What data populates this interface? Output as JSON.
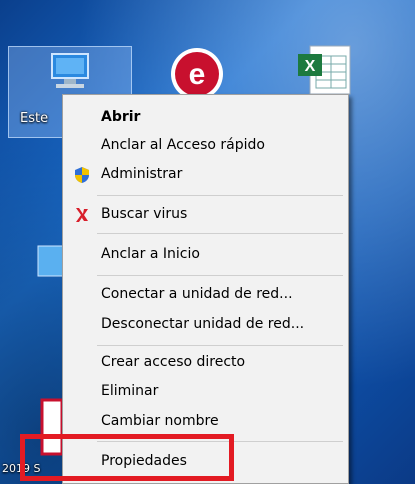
{
  "desktop": {
    "selected_icon_label": "Este",
    "bottom_left_label": "2019 S"
  },
  "menu": {
    "items": [
      {
        "label": "Abrir",
        "bold": true
      },
      {
        "label": "Anclar al Acceso rápido"
      },
      {
        "label": "Administrar",
        "icon": "uac-shield-icon"
      },
      {
        "label": "Buscar virus",
        "icon": "antivirus-icon"
      },
      {
        "label": "Anclar a Inicio"
      },
      {
        "label": "Conectar a unidad de red..."
      },
      {
        "label": "Desconectar unidad de red..."
      },
      {
        "label": "Crear acceso directo"
      },
      {
        "label": "Eliminar"
      },
      {
        "label": "Cambiar nombre"
      },
      {
        "label": "Propiedades"
      }
    ]
  },
  "colors": {
    "highlight": "#e31b23",
    "desktop": "#1b6fd0",
    "menu_bg": "#f2f2f2"
  }
}
